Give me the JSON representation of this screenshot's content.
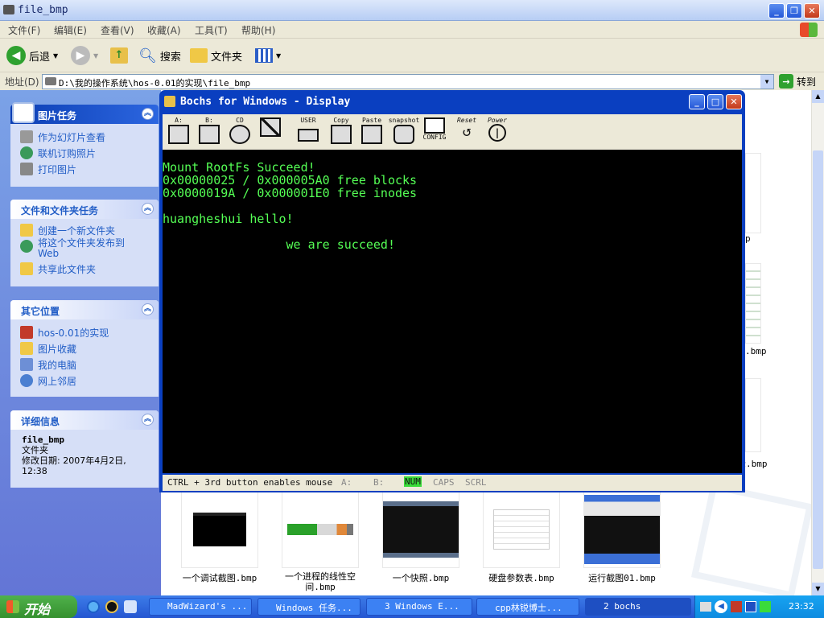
{
  "window": {
    "title": "file_bmp"
  },
  "menu": [
    "文件(F)",
    "编辑(E)",
    "查看(V)",
    "收藏(A)",
    "工具(T)",
    "帮助(H)"
  ],
  "toolbar": {
    "back": "后退",
    "search": "搜索",
    "folders": "文件夹"
  },
  "address": {
    "label": "地址(D)",
    "path": "D:\\我的操作系统\\hos-0.01的实现\\file_bmp",
    "go": "转到"
  },
  "sidebar": {
    "picture_tasks": {
      "title": "图片任务",
      "items": [
        "作为幻灯片查看",
        "联机订购照片",
        "打印图片"
      ]
    },
    "file_tasks": {
      "title": "文件和文件夹任务",
      "items": [
        "创建一个新文件夹",
        "将这个文件夹发布到Web",
        "共享此文件夹"
      ]
    },
    "other_places": {
      "title": "其它位置",
      "items": [
        "hos-0.01的实现",
        "图片收藏",
        "我的电脑",
        "网上邻居"
      ]
    },
    "details": {
      "title": "详细信息",
      "name": "file_bmp",
      "type": "文件夹",
      "modified": "修改日期: 2007年4月2日, 12:38"
    }
  },
  "files": [
    "一个调试截图.bmp",
    "一个进程的线性空间.bmp",
    "一个快照.bmp",
    "硬盘参数表.bmp",
    "运行截图01.bmp"
  ],
  "partial_captions": [
    "p",
    ".bmp",
    "示.bmp"
  ],
  "bochs": {
    "title": "Bochs for Windows - Display",
    "tools": [
      "A:",
      "B:",
      "CD",
      "",
      "USER",
      "Copy",
      "Paste",
      "snapshot",
      "CONFIG",
      "Reset",
      "Power"
    ],
    "console_lines": [
      "Mount RootFs Succeed!",
      "0x00000025 / 0x000005A0 free blocks",
      "0x0000019A / 0x000001E0 free inodes",
      "",
      "huangheshui hello!",
      "",
      "                 we are succeed!"
    ],
    "status": {
      "mouse": "CTRL + 3rd button enables mouse",
      "a": "A:",
      "b": "B:",
      "num": "NUM",
      "caps": "CAPS",
      "scrl": "SCRL"
    }
  },
  "taskbar": {
    "start": "开始",
    "tasks": [
      "MadWizard's ...",
      "Windows 任务...",
      "3 Windows E...",
      "cpp林锐博士...",
      "2 bochs"
    ],
    "clock": "23:32"
  }
}
